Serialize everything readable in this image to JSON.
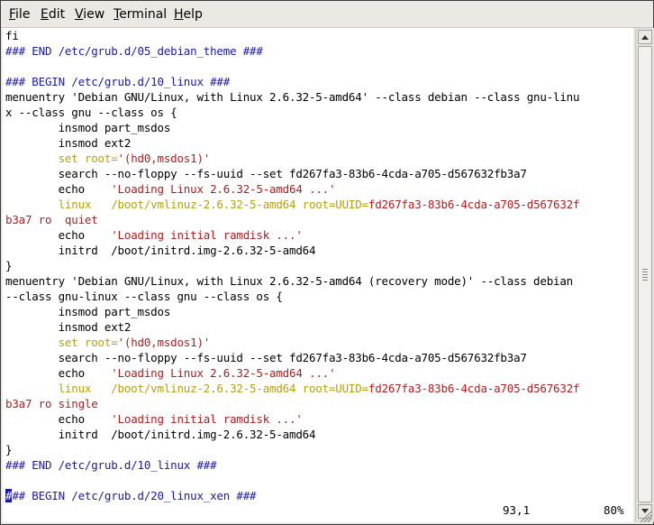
{
  "menubar": {
    "items": [
      {
        "mnemonic": "F",
        "rest": "ile"
      },
      {
        "mnemonic": "E",
        "rest": "dit"
      },
      {
        "mnemonic": "V",
        "rest": "iew"
      },
      {
        "mnemonic": "T",
        "rest": "erminal"
      },
      {
        "mnemonic": "H",
        "rest": "elp"
      }
    ]
  },
  "lines": [
    [
      {
        "t": "fi",
        "c": ""
      }
    ],
    [
      {
        "t": "### END /etc/grub.d/05_debian_theme ###",
        "c": "blue"
      }
    ],
    [
      {
        "t": "",
        "c": ""
      }
    ],
    [
      {
        "t": "### BEGIN /etc/grub.d/10_linux ###",
        "c": "blue"
      }
    ],
    [
      {
        "t": "menuentry 'Debian GNU/Linux, with Linux 2.6.32-5-amd64' --class debian --class gnu-linu",
        "c": ""
      }
    ],
    [
      {
        "t": "x --class gnu --class os {",
        "c": ""
      }
    ],
    [
      {
        "t": "        insmod part_msdos",
        "c": ""
      }
    ],
    [
      {
        "t": "        insmod ext2",
        "c": ""
      }
    ],
    [
      {
        "t": "        set root=",
        "c": "ylw"
      },
      {
        "t": "'(hd0,msdos1)'",
        "c": "red"
      }
    ],
    [
      {
        "t": "        search --no-floppy --fs-uuid --set fd267fa3-83b6-4cda-a705-d567632fb3a7",
        "c": ""
      }
    ],
    [
      {
        "t": "        echo    ",
        "c": ""
      },
      {
        "t": "'Loading Linux 2.6.32-5-amd64 ...'",
        "c": "red"
      }
    ],
    [
      {
        "t": "        linux   /boot/vmlinuz-2.6.32-5-amd64 root=UUID=",
        "c": "ylw"
      },
      {
        "t": "fd267fa3-83b6-4cda-a705-d567632f",
        "c": "red"
      }
    ],
    [
      {
        "t": "b3a7 ro  quiet",
        "c": "red"
      }
    ],
    [
      {
        "t": "        echo    ",
        "c": ""
      },
      {
        "t": "'Loading initial ramdisk ...'",
        "c": "red"
      }
    ],
    [
      {
        "t": "        initrd  /boot/initrd.img-2.6.32-5-amd64",
        "c": ""
      }
    ],
    [
      {
        "t": "}",
        "c": ""
      }
    ],
    [
      {
        "t": "menuentry 'Debian GNU/Linux, with Linux 2.6.32-5-amd64 (recovery mode)' --class debian",
        "c": ""
      }
    ],
    [
      {
        "t": "--class gnu-linux --class gnu --class os {",
        "c": ""
      }
    ],
    [
      {
        "t": "        insmod part_msdos",
        "c": ""
      }
    ],
    [
      {
        "t": "        insmod ext2",
        "c": ""
      }
    ],
    [
      {
        "t": "        set root=",
        "c": "ylw"
      },
      {
        "t": "'(hd0,msdos1)'",
        "c": "red"
      }
    ],
    [
      {
        "t": "        search --no-floppy --fs-uuid --set fd267fa3-83b6-4cda-a705-d567632fb3a7",
        "c": ""
      }
    ],
    [
      {
        "t": "        echo    ",
        "c": ""
      },
      {
        "t": "'Loading Linux 2.6.32-5-amd64 ...'",
        "c": "red"
      }
    ],
    [
      {
        "t": "        linux   /boot/vmlinuz-2.6.32-5-amd64 root=UUID=",
        "c": "ylw"
      },
      {
        "t": "fd267fa3-83b6-4cda-a705-d567632f",
        "c": "red"
      }
    ],
    [
      {
        "t": "b3a7 ro single",
        "c": "red"
      }
    ],
    [
      {
        "t": "        echo    ",
        "c": ""
      },
      {
        "t": "'Loading initial ramdisk ...'",
        "c": "red"
      }
    ],
    [
      {
        "t": "        initrd  /boot/initrd.img-2.6.32-5-amd64",
        "c": ""
      }
    ],
    [
      {
        "t": "}",
        "c": ""
      }
    ],
    [
      {
        "t": "### END /etc/grub.d/10_linux ###",
        "c": "blue"
      }
    ],
    [
      {
        "t": "",
        "c": ""
      }
    ],
    [
      {
        "t": "#",
        "c": "cursor"
      },
      {
        "t": "## BEGIN /etc/grub.d/20_linux_xen ###",
        "c": "blue"
      }
    ]
  ],
  "status": {
    "position": "93,1",
    "percent": "80%"
  },
  "icons": {
    "scroll_up": "arrow-up-icon",
    "scroll_down": "arrow-down-icon",
    "resize": "resize-grip-icon"
  },
  "colors": {
    "comment": "#1a1aa8",
    "keyword": "#b5a10d",
    "string": "#b01e1e"
  }
}
